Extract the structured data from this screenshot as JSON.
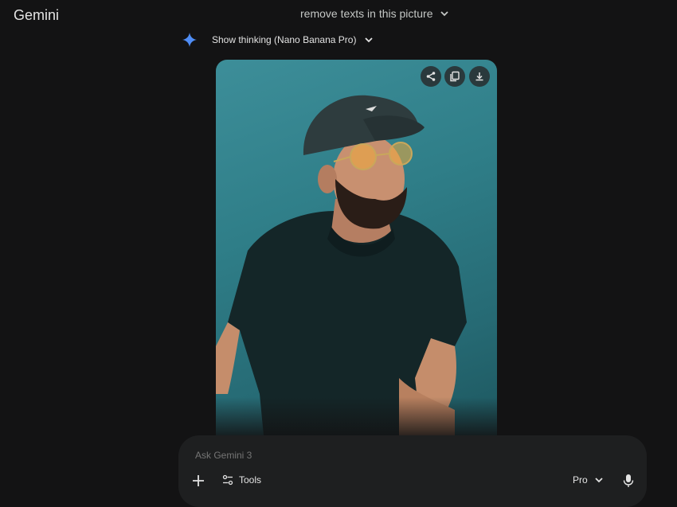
{
  "app": {
    "name": "Gemini"
  },
  "chat": {
    "title": "remove texts in this picture"
  },
  "thinking": {
    "label": "Show thinking (Nano Banana Pro)"
  },
  "image_card": {
    "actions": [
      {
        "icon": "share-icon"
      },
      {
        "icon": "copy-icon"
      },
      {
        "icon": "download-icon"
      }
    ]
  },
  "composer": {
    "placeholder": "Ask Gemini 3",
    "tools_label": "Tools",
    "model_label": "Pro"
  },
  "colors": {
    "background": "#131314",
    "composer": "#1e1f20",
    "spark_blue": "#4f8df5",
    "photo_teal": "#2f7e88"
  }
}
